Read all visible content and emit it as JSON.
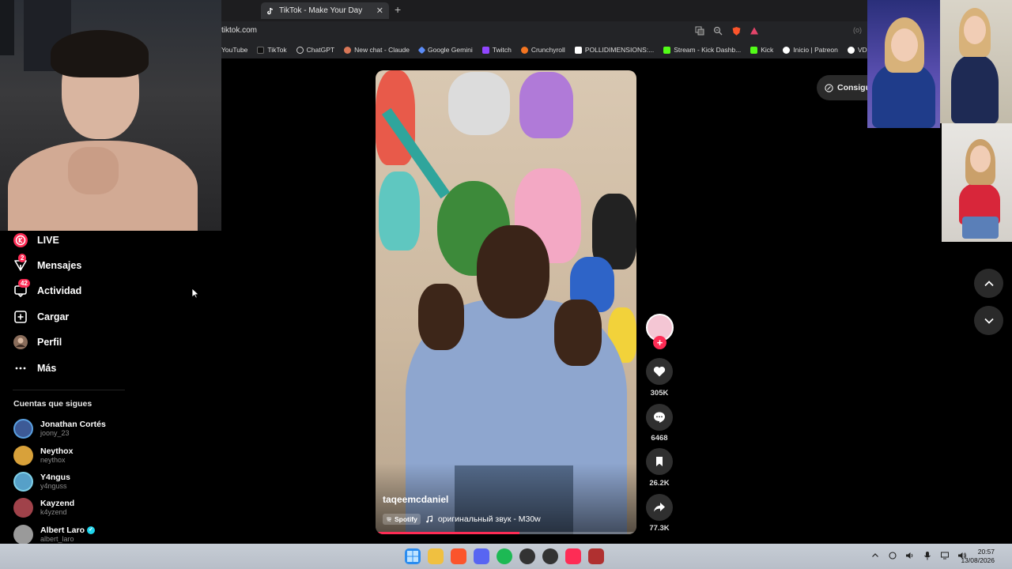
{
  "browser": {
    "tab_title": "TikTok - Make Your Day",
    "tab_close": "✕",
    "new_tab": "+",
    "url": "tiktok.com",
    "addr_right": "(o)",
    "bookmarks": [
      "YouTube",
      "TikTok",
      "ChatGPT",
      "New chat - Claude",
      "Google Gemini",
      "Twitch",
      "Crunchyroll",
      "POLLIDIMENSIONS:...",
      "Stream - Kick Dashb...",
      "Kick",
      "Inicio | Patreon",
      "VDO.Ninja"
    ]
  },
  "sidebar": {
    "items": [
      {
        "label": "LIVE",
        "icon": "live-icon"
      },
      {
        "label": "Mensajes",
        "icon": "messages-icon",
        "badge": "2"
      },
      {
        "label": "Actividad",
        "icon": "activity-icon",
        "badge": "42"
      },
      {
        "label": "Cargar",
        "icon": "upload-icon"
      },
      {
        "label": "Perfil",
        "icon": "profile-avatar"
      },
      {
        "label": "Más",
        "icon": "more-icon"
      }
    ],
    "following_title": "Cuentas que sigues",
    "accounts": [
      {
        "name": "Jonathan Cortés",
        "user": "joony_23",
        "color": "#3d5a96"
      },
      {
        "name": "Neythox",
        "user": "neythox",
        "color": "#d8a13a"
      },
      {
        "name": "Y4ngus",
        "user": "y4nguss",
        "color": "#56a0c8"
      },
      {
        "name": "Kayzend",
        "user": "k4yzend",
        "color": "#a0424a"
      },
      {
        "name": "Albert Laro",
        "user": "albert_laro",
        "color": "#9a9a9a",
        "verified": true
      }
    ]
  },
  "video": {
    "author": "taqeemcdaniel",
    "spotify": "Spotify",
    "music": "оригинальный звук - M30w",
    "progress": 0.55
  },
  "actions": {
    "likes": "305K",
    "comments": "6468",
    "saves": "26.2K",
    "shares": "77.3K",
    "follow": "+"
  },
  "right": {
    "get_button": "Consigue"
  },
  "taskbar": {
    "time": "20:57",
    "date": "13/08/2026"
  },
  "colors": {
    "accent": "#fe2c55",
    "verified": "#20d5ec"
  }
}
